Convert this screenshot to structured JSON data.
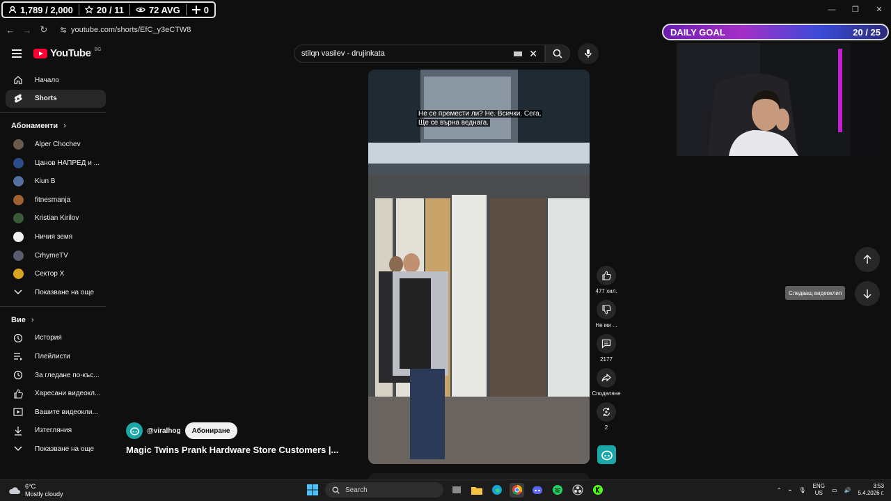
{
  "overlay": {
    "followers": "1,789 / 2,000",
    "subs": "20 / 11",
    "viewers": "72 AVG",
    "extra": "0",
    "daily_goal_label": "DAILY GOAL",
    "daily_goal_value": "20 / 25"
  },
  "browser": {
    "url": "youtube.com/shorts/EfC_y3eCTW8"
  },
  "header": {
    "logo_text": "YouTube",
    "logo_region": "BG",
    "search_value": "stilqn vasilev - drujinkata"
  },
  "sidebar": {
    "main": [
      {
        "label": "Начало",
        "icon": "home-icon"
      },
      {
        "label": "Shorts",
        "icon": "shorts-icon"
      }
    ],
    "subs_title": "Абонаменти",
    "subscriptions": [
      {
        "label": "Alper Chochev",
        "color": "#6b5a4a"
      },
      {
        "label": "Цанов НАПРЕД и ...",
        "color": "#2d4a8a"
      },
      {
        "label": "Kiun B",
        "color": "#5570a0"
      },
      {
        "label": "fitnesmanja",
        "color": "#a06030"
      },
      {
        "label": "Kristian Kirilov",
        "color": "#3a5a3a"
      },
      {
        "label": "Ничия земя",
        "color": "#f1f1f1"
      },
      {
        "label": "CrhymeTV",
        "color": "#5a5a70"
      },
      {
        "label": "Сектор X",
        "color": "#d9a520"
      }
    ],
    "show_more_1": "Показване на още",
    "you_title": "Вие",
    "you_items": [
      {
        "label": "История",
        "icon": "history-icon"
      },
      {
        "label": "Плейлисти",
        "icon": "playlist-icon"
      },
      {
        "label": "За гледане по-къс...",
        "icon": "clock-icon"
      },
      {
        "label": "Харесани видеокл...",
        "icon": "like-icon"
      },
      {
        "label": "Вашите видеокли...",
        "icon": "video-icon"
      },
      {
        "label": "Изтегляния",
        "icon": "download-icon"
      }
    ],
    "show_more_2": "Показване на още"
  },
  "video": {
    "caption_line1": "Не се премести ли? Не. Всички. Сега,",
    "caption_line2": "Ще се върна веднага."
  },
  "actions": {
    "likes": "477 хил.",
    "dislike": "Не ми ...",
    "comments": "2177",
    "share": "Споделяне",
    "remix": "2"
  },
  "channel": {
    "handle": "@viralhog",
    "subscribe": "Абониране",
    "title": "Magic Twins Prank Hardware Store Customers |..."
  },
  "nav": {
    "next_tooltip": "Следващ видеоклип"
  },
  "taskbar": {
    "temp": "6°C",
    "weather": "Mostly cloudy",
    "search": "Search",
    "lang1": "ENG",
    "lang2": "US",
    "time": "3:53",
    "date": "5.4.2026 г."
  }
}
